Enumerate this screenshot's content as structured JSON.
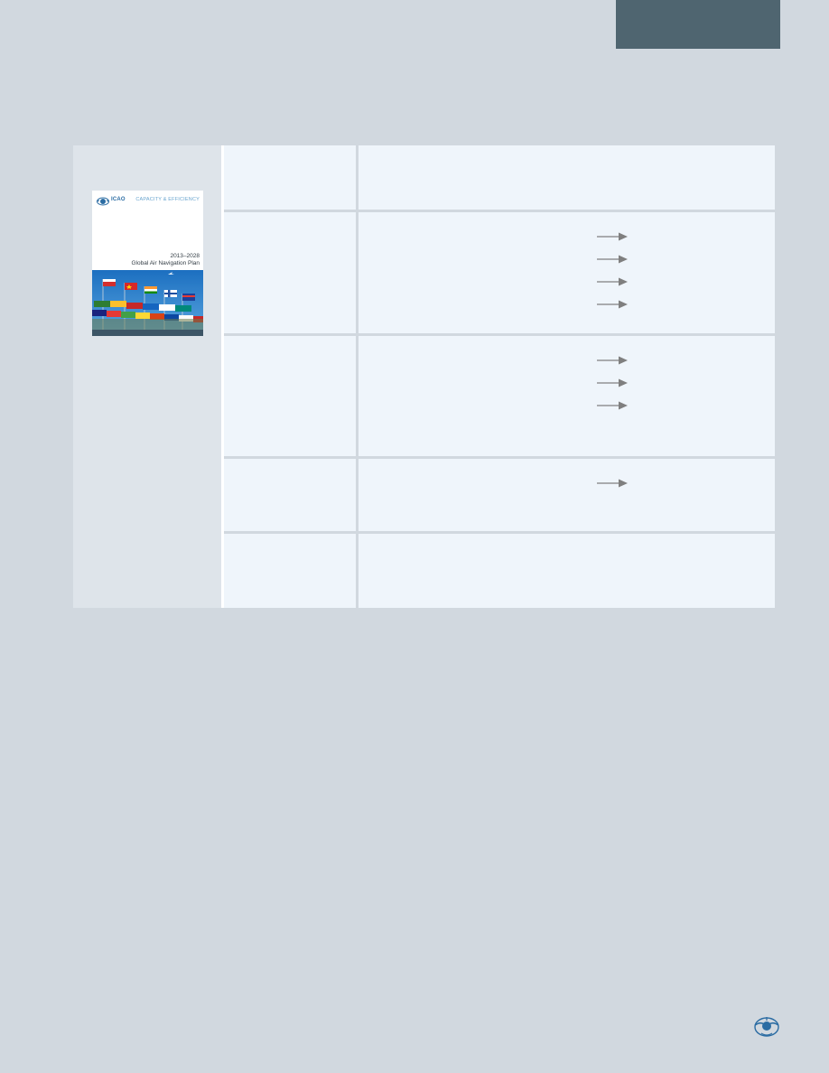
{
  "cover": {
    "logo_text": "ICAO",
    "category": "CAPACITY & EFFICIENCY",
    "years": "2013–2028",
    "title": "Global Air Navigation Plan"
  },
  "rows": [
    {
      "id": "row-1",
      "arrows": 0
    },
    {
      "id": "row-2",
      "arrows": 4
    },
    {
      "id": "row-3",
      "arrows": 3
    },
    {
      "id": "row-4",
      "arrows": 1
    },
    {
      "id": "row-5",
      "arrows": 0
    }
  ],
  "colors": {
    "page_background": "#d1d8df",
    "header_tab": "#4f6570",
    "cell_background": "#eff5fb",
    "cover_column": "#dee4ea",
    "arrow": "#7f7f7f"
  },
  "icons": {
    "arrow": "right-arrow-icon",
    "emblem": "icao-emblem-icon"
  }
}
